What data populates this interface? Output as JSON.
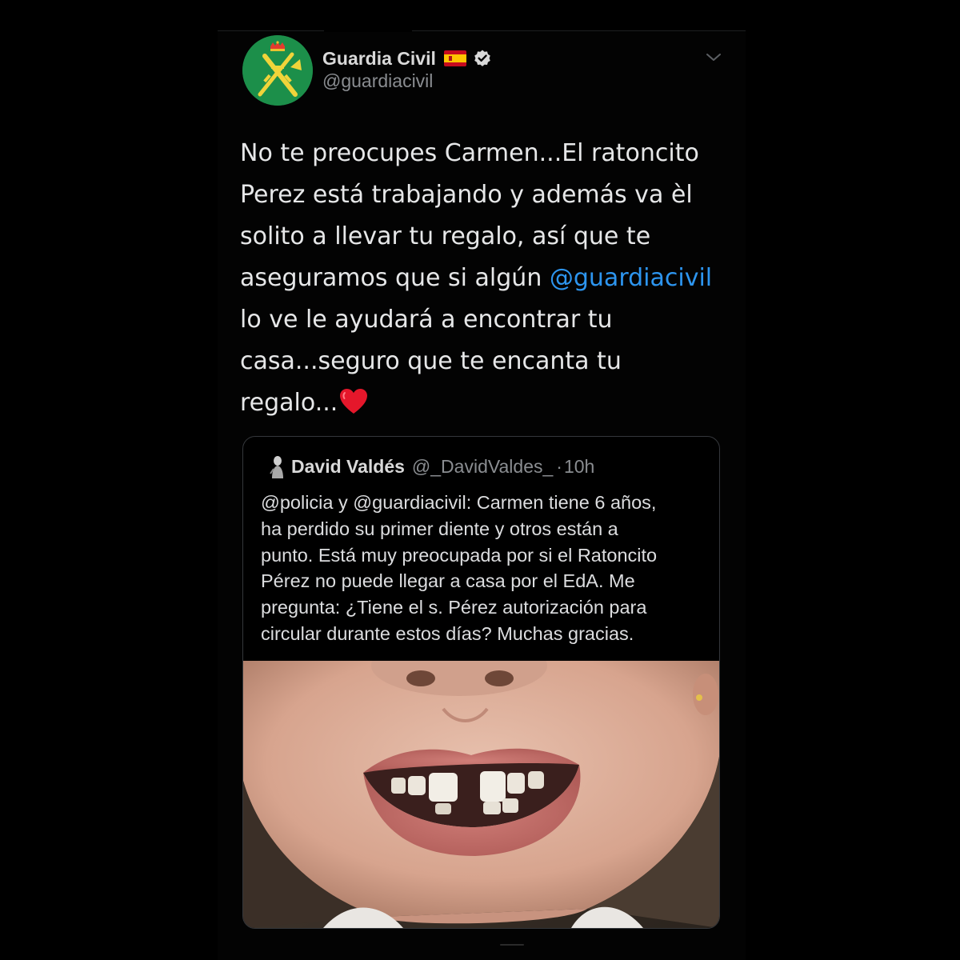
{
  "tweet": {
    "display_name": "Guardia Civil",
    "handle": "@guardiacivil",
    "avatar_icon": "guardia-civil-emblem-icon",
    "flag_icon": "spain-flag-icon",
    "verified_icon": "verified-badge-icon",
    "menu_icon": "chevron-down-icon",
    "text_lines": [
      "No te preocupes Carmen...El ratoncito",
      "Perez está trabajando y además va èl",
      "solito a llevar tu regalo, así que te",
      "aseguramos que si algún ",
      "lo ve le ayudará a encontrar tu",
      "casa...seguro que te encanta tu",
      "regalo..."
    ],
    "mention": "@guardiacivil",
    "heart_icon": "red-heart-icon"
  },
  "quoted_tweet": {
    "display_name": "David Valdés",
    "handle": "@_DavidValdes_",
    "separator": "·",
    "time": "10h",
    "text_lines": [
      "@policia y @guardiacivil: Carmen tiene 6 años,",
      "ha perdido su primer diente y otros están a",
      "punto. Está muy preocupada por si el Ratoncito",
      "Pérez no puede llegar a casa por el EdA. Me",
      "pregunta: ¿Tiene el s. Pérez autorización para",
      "circular durante estos días? Muchas gracias."
    ],
    "media": "photo-child-smile-missing-tooth"
  },
  "colors": {
    "background": "#000000",
    "text_primary": "#e6e7e8",
    "text_secondary": "#8a8d91",
    "link": "#2d95ef",
    "card_border": "#34373b",
    "avatar_green": "#1c8f4a"
  }
}
